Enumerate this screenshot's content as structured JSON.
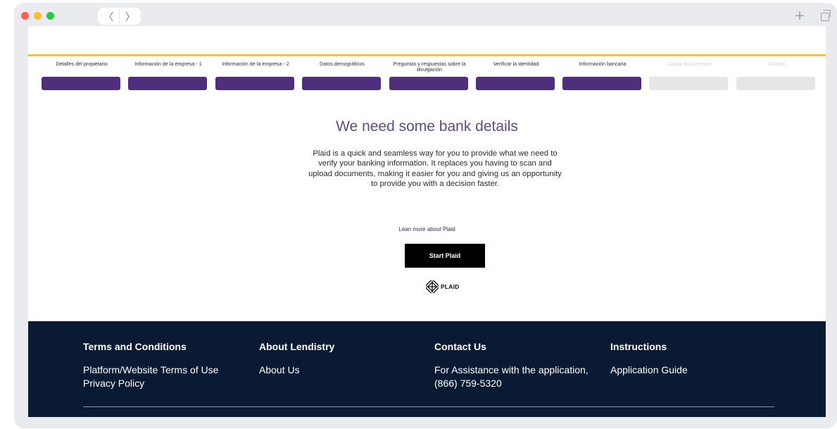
{
  "browser": {
    "back_glyph": "〈",
    "forward_glyph": "〉",
    "new_tab_glyph": "+",
    "icons": [
      "close-dot",
      "minimize-dot",
      "maximize-dot",
      "back-icon",
      "forward-icon",
      "plus-icon",
      "tabs-icon"
    ]
  },
  "colors": {
    "accent_line": "#f3bf3a",
    "step_active": "#4f2f7d",
    "step_inactive": "#e6e6e6",
    "footer_bg": "#0b1a33",
    "title": "#5c4d7a"
  },
  "steps": [
    {
      "label": "Detalles del propietario",
      "state": "complete"
    },
    {
      "label": "Información de la empresa - 1",
      "state": "complete"
    },
    {
      "label": "Información de la empresa - 2",
      "state": "complete"
    },
    {
      "label": "Datos demográficos",
      "state": "complete"
    },
    {
      "label": "Preguntas y respuestas sobre la divulgación",
      "state": "complete"
    },
    {
      "label": "Verificar la identidad",
      "state": "complete"
    },
    {
      "label": "Información bancaria",
      "state": "current"
    },
    {
      "label": "Cargar documentos",
      "state": "disabled"
    },
    {
      "label": "Solicitar",
      "state": "disabled"
    }
  ],
  "main": {
    "title": "We need some bank details",
    "intro": "Plaid is a quick and seamless way for you to provide what we need to verify your banking information. It replaces you having to scan and upload documents, making it easier for you and giving us an opportunity to provide you with a decision faster.",
    "learn_more": "Lean more about Plaid",
    "start_button": "Start Plaid",
    "plaid_logo_text": "PLAID"
  },
  "footer": {
    "columns": [
      {
        "heading": "Terms and Conditions",
        "links": [
          "Platform/Website Terms of Use",
          "Privacy Policy"
        ]
      },
      {
        "heading": "About Lendistry",
        "links": [
          "About Us"
        ]
      },
      {
        "heading": "Contact Us",
        "links": [
          "For Assistance with the application,",
          "(866) 759-5320"
        ]
      },
      {
        "heading": "Instructions",
        "links": [
          "Application Guide"
        ]
      }
    ]
  }
}
